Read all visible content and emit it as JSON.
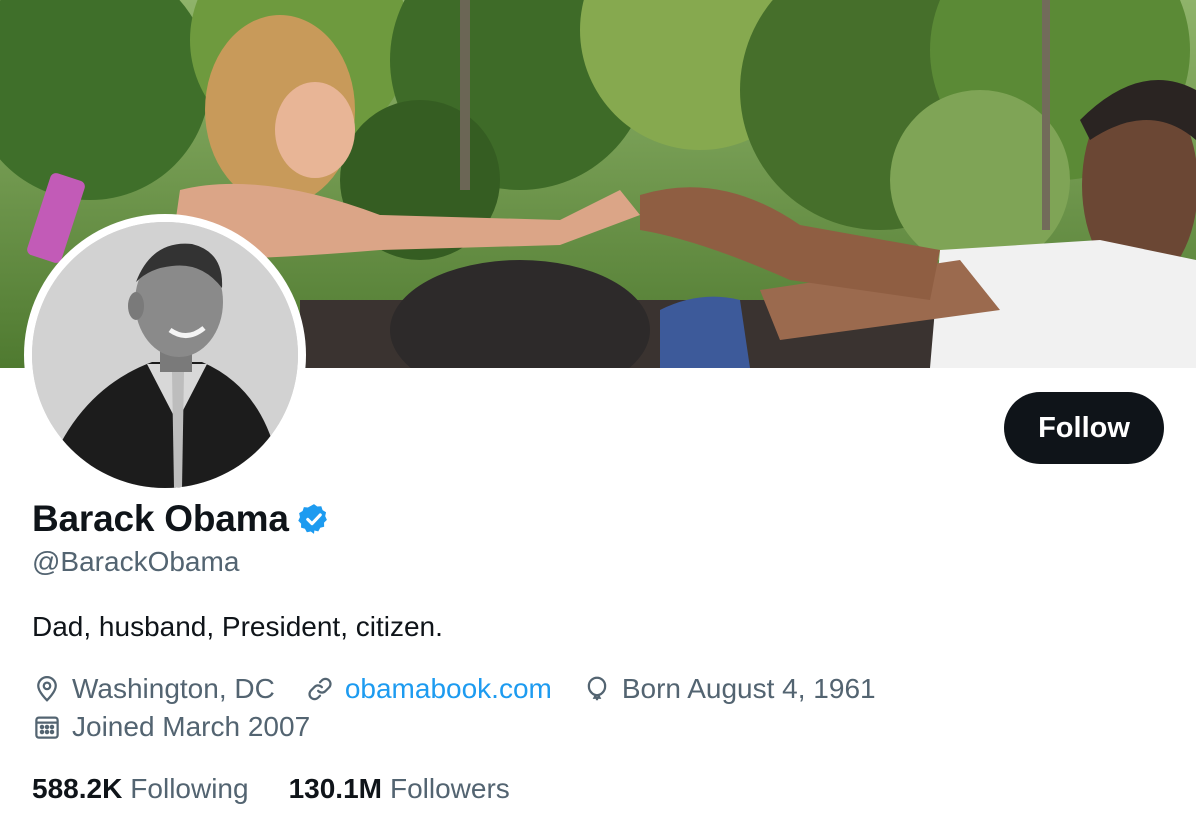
{
  "profile": {
    "display_name": "Barack Obama",
    "verified": true,
    "handle": "@BarackObama",
    "bio": "Dad, husband, President, citizen.",
    "location": "Washington, DC",
    "website": "obamabook.com",
    "birthday": "Born August 4, 1961",
    "joined": "Joined March 2007",
    "following_count": "588.2K",
    "following_label": "Following",
    "followers_count": "130.1M",
    "followers_label": "Followers"
  },
  "actions": {
    "follow_label": "Follow"
  },
  "icons": {
    "verified": "verified-badge-icon",
    "location": "location-pin-icon",
    "website": "link-icon",
    "birthday": "balloon-icon",
    "joined": "calendar-icon"
  },
  "colors": {
    "text_primary": "#0f1419",
    "text_secondary": "#536471",
    "link": "#1d9bf0",
    "verified": "#1d9bf0",
    "follow_button_bg": "#0f1419",
    "follow_button_text": "#ffffff"
  }
}
